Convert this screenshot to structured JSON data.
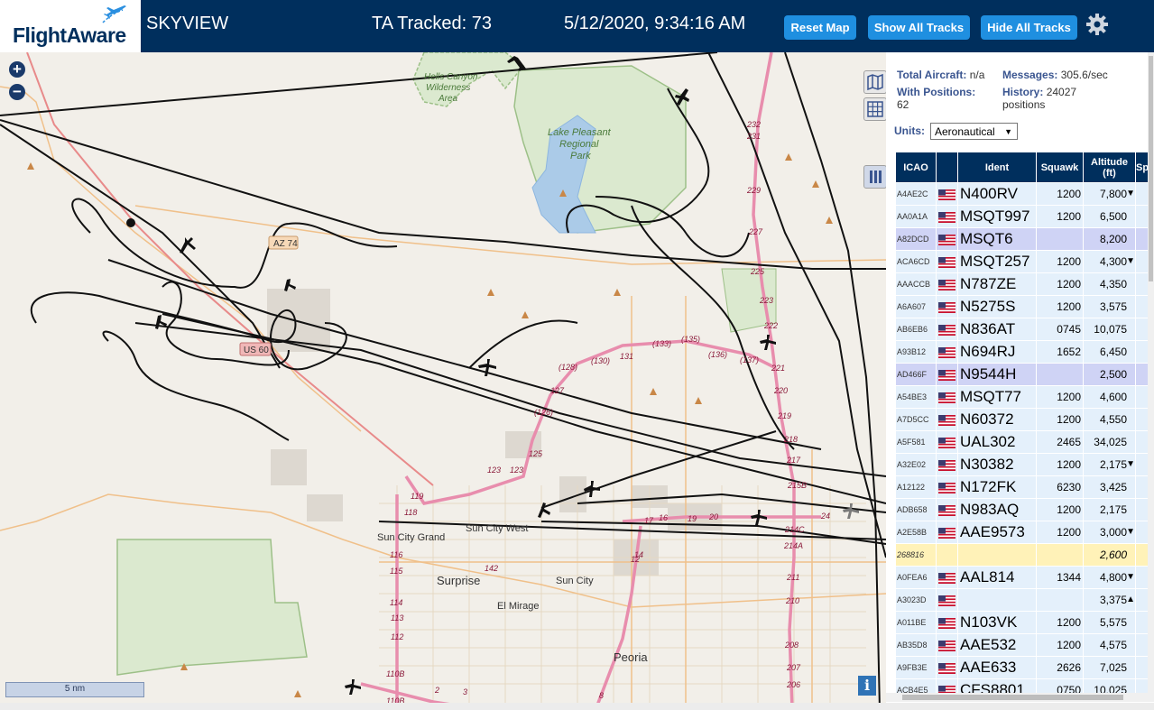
{
  "header": {
    "logo_text": "FlightAware",
    "app_name": "SKYVIEW",
    "tracked": "TA Tracked: 73",
    "datetime": "5/12/2020, 9:34:16 AM",
    "buttons": {
      "reset": "Reset Map",
      "show": "Show All Tracks",
      "hide": "Hide All Tracks"
    },
    "bg_color": "#002f5d",
    "button_color": "#1f8fe0"
  },
  "map": {
    "zoom_in": "+",
    "zoom_out": "−",
    "scale_label": "5 nm",
    "info_label": "i",
    "place_labels": [
      "Hells Canyon Wilderness Area",
      "Lake Pleasant Regional Park",
      "Sun City West",
      "Sun City Grand",
      "Surprise",
      "Sun City",
      "El Mirage",
      "Peoria"
    ],
    "road_shields": [
      "AZ 74",
      "US 60"
    ],
    "route_numbers": [
      "232",
      "231",
      "229",
      "227",
      "225",
      "223",
      "222",
      "221",
      "220",
      "219",
      "218",
      "217",
      "215B",
      "214C",
      "214A",
      "211",
      "210",
      "208",
      "207",
      "206",
      "128",
      "130",
      "131",
      "133",
      "135",
      "136",
      "137",
      "127",
      "126",
      "125",
      "123",
      "119",
      "118",
      "116",
      "115",
      "114",
      "113",
      "112",
      "110B",
      "2",
      "3",
      "8",
      "12",
      "14",
      "16",
      "17",
      "19",
      "20",
      "24",
      "142"
    ]
  },
  "panel": {
    "total_aircraft_label": "Total Aircraft:",
    "total_aircraft_value": "n/a",
    "with_positions_label": "With Positions:",
    "with_positions_value": "62",
    "messages_label": "Messages:",
    "messages_value": "305.6/sec",
    "history_label": "History:",
    "history_value": "24027",
    "history_unit": "positions",
    "units_label": "Units:",
    "units_value": "Aeronautical",
    "columns": [
      "ICAO",
      "",
      "Ident",
      "Squawk",
      "Altitude (ft)",
      "Sp"
    ],
    "rows": [
      {
        "icao": "A4AE2C",
        "ident": "N400RV",
        "squawk": "1200",
        "alt": "7,800",
        "arrow": "▼"
      },
      {
        "icao": "AA0A1A",
        "ident": "MSQT997",
        "squawk": "1200",
        "alt": "6,500",
        "arrow": ""
      },
      {
        "icao": "A82DCD",
        "ident": "MSQT6",
        "squawk": "",
        "alt": "8,200",
        "arrow": ""
      },
      {
        "icao": "ACA6CD",
        "ident": "MSQT257",
        "squawk": "1200",
        "alt": "4,300",
        "arrow": "▼"
      },
      {
        "icao": "AAACCB",
        "ident": "N787ZE",
        "squawk": "1200",
        "alt": "4,350",
        "arrow": ""
      },
      {
        "icao": "A6A607",
        "ident": "N5275S",
        "squawk": "1200",
        "alt": "3,575",
        "arrow": ""
      },
      {
        "icao": "AB6EB6",
        "ident": "N836AT",
        "squawk": "0745",
        "alt": "10,075",
        "arrow": ""
      },
      {
        "icao": "A93B12",
        "ident": "N694RJ",
        "squawk": "1652",
        "alt": "6,450",
        "arrow": ""
      },
      {
        "icao": "AD466F",
        "ident": "N9544H",
        "squawk": "",
        "alt": "2,500",
        "arrow": ""
      },
      {
        "icao": "A54BE3",
        "ident": "MSQT77",
        "squawk": "1200",
        "alt": "4,600",
        "arrow": ""
      },
      {
        "icao": "A7D5CC",
        "ident": "N60372",
        "squawk": "1200",
        "alt": "4,550",
        "arrow": ""
      },
      {
        "icao": "A5F581",
        "ident": "UAL302",
        "squawk": "2465",
        "alt": "34,025",
        "arrow": ""
      },
      {
        "icao": "A32E02",
        "ident": "N30382",
        "squawk": "1200",
        "alt": "2,175",
        "arrow": "▼"
      },
      {
        "icao": "A12122",
        "ident": "N172FK",
        "squawk": "6230",
        "alt": "3,425",
        "arrow": ""
      },
      {
        "icao": "ADB658",
        "ident": "N983AQ",
        "squawk": "1200",
        "alt": "2,175",
        "arrow": ""
      },
      {
        "icao": "A2E58B",
        "ident": "AAE9573",
        "squawk": "1200",
        "alt": "3,000",
        "arrow": "▼"
      },
      {
        "icao": "268816",
        "ident": "",
        "squawk": "",
        "alt": "2,600",
        "arrow": ""
      },
      {
        "icao": "A0FEA6",
        "ident": "AAL814",
        "squawk": "1344",
        "alt": "4,800",
        "arrow": "▼"
      },
      {
        "icao": "A3023D",
        "ident": "",
        "squawk": "",
        "alt": "3,375",
        "arrow": "▲"
      },
      {
        "icao": "A011BE",
        "ident": "N103VK",
        "squawk": "1200",
        "alt": "5,575",
        "arrow": ""
      },
      {
        "icao": "AB35D8",
        "ident": "AAE532",
        "squawk": "1200",
        "alt": "4,575",
        "arrow": ""
      },
      {
        "icao": "A9FB3E",
        "ident": "AAE633",
        "squawk": "2626",
        "alt": "7,025",
        "arrow": ""
      },
      {
        "icao": "ACB4E5",
        "ident": "CFS8801",
        "squawk": "0750",
        "alt": "10,025",
        "arrow": ""
      }
    ]
  }
}
